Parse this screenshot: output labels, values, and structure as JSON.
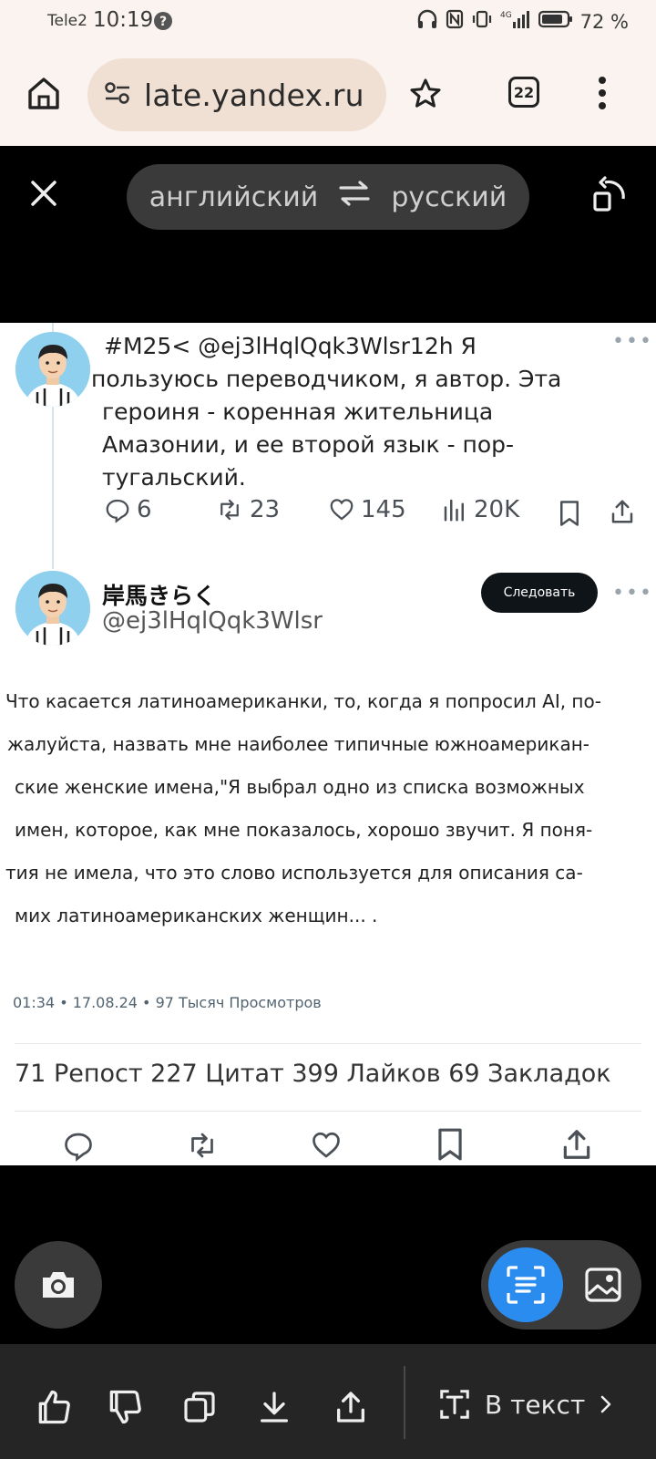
{
  "status_bar": {
    "carrier": "Tele2",
    "time": "10:19",
    "battery": "72 %"
  },
  "browser": {
    "url": "late.yandex.ru",
    "tab_count": "22"
  },
  "translator": {
    "source_lang": "английский",
    "target_lang": "русский"
  },
  "reply": {
    "lines": [
      "#M25< @ej3lHqlQqk3Wlsr12h Я",
      "пользуюсь переводчиком, я автор. Эта",
      "героиня - коренная жительница",
      "Амазонии, и ее второй язык - пор-",
      "тугальский."
    ],
    "replies": "6",
    "reposts": "23",
    "likes": "145",
    "views": "20K"
  },
  "tweet": {
    "display_name": "岸馬きらく",
    "handle": "@ej3lHqlQqk3Wlsr",
    "follow_label": "Следовать",
    "body_lines": [
      "Что касается латиноамериканки, то, когда я попросил AI, по-",
      "жалуйста, назвать мне наиболее типичные южноамерикан-",
      "ские женские имена,\"Я выбрал одно из списка возможных",
      "имен, которое, как мне показалось, хорошо звучит. Я поня-",
      "тия не имела, что это слово используется для описания са-",
      "мих латиноамериканских женщин... ."
    ],
    "meta": "01:34 • 17.08.24 • 97 Тысяч Просмотров",
    "totals": "71 Репост 227 Цитат 399 Лайков 69 Закладок"
  },
  "bottom_toolbar": {
    "to_text_label": "В текст"
  },
  "colors": {
    "browser_bg": "#fbf3ef",
    "url_pill": "#f0dfd3",
    "lang_pill": "#3a3a3a",
    "accent_blue": "#2b8cf0",
    "toolbar_bg": "#252525"
  }
}
